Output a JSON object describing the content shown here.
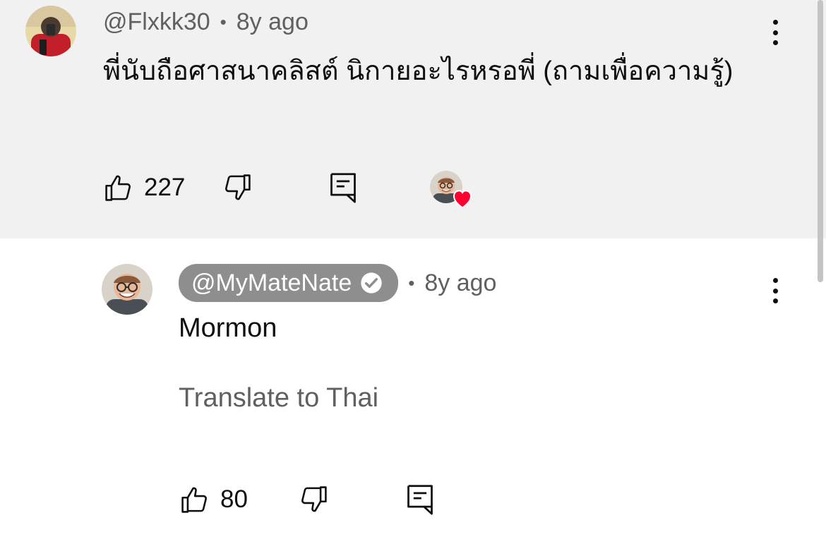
{
  "comments": [
    {
      "author": "@Flxkk30",
      "separator": "•",
      "time": "8y ago",
      "text": "พี่นับถือศาสนาคลิสต์ นิกายอะไรหรอพี่ (ถามเพื่อความรู้)",
      "like_count": "227",
      "creator_heart": true,
      "menu_icon": "more-vert-icon"
    }
  ],
  "reply": {
    "author": "@MyMateNate",
    "verified": true,
    "separator": "•",
    "time": "8y ago",
    "text": "Mormon",
    "translate_label": "Translate to Thai",
    "like_count": "80",
    "menu_icon": "more-vert-icon"
  },
  "colors": {
    "highlight_bg": "#f1f1f1",
    "heart": "#ff0033",
    "pill_bg": "#8e8e8e",
    "secondary_text": "#606060"
  }
}
